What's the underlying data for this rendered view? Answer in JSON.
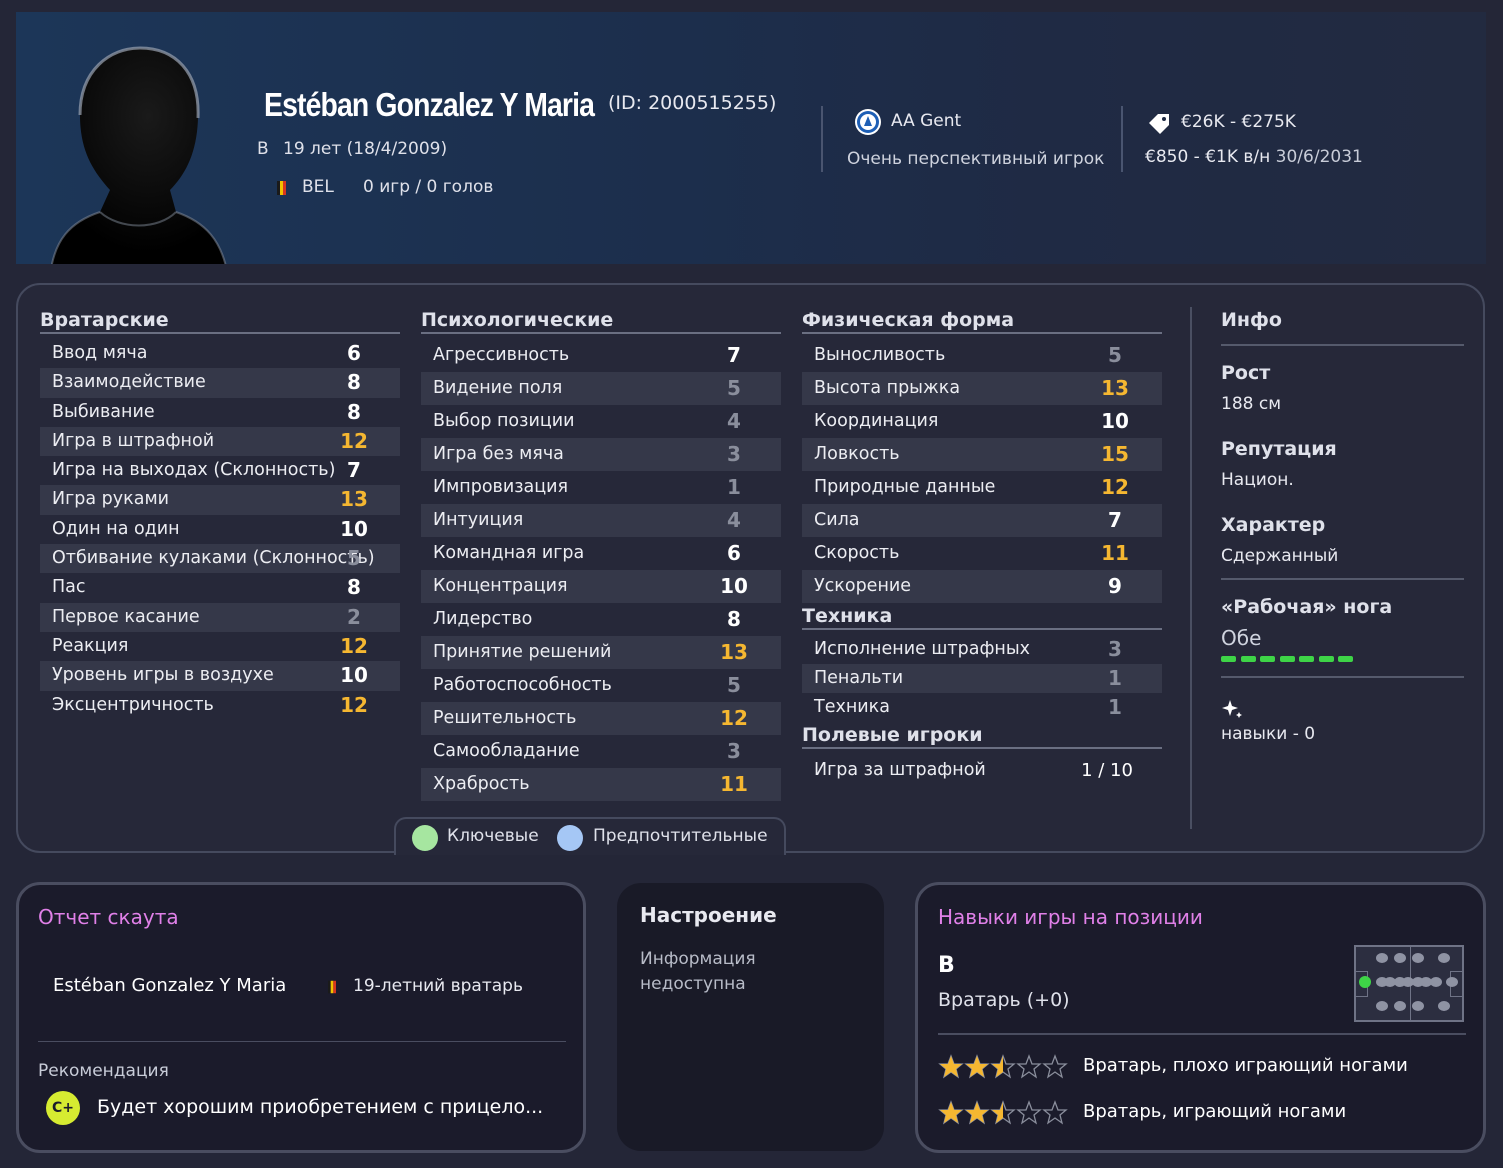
{
  "player": {
    "name": "Estéban Gonzalez Y Maria",
    "id_text": "(ID: 2000515255)",
    "position_letter": "В",
    "age_text": "19 лет (18/4/2009)",
    "nation": "BEL",
    "caps_text": "0 игр / 0 голов"
  },
  "club": {
    "name": "AA Gent",
    "status": "Очень перспективный игрок"
  },
  "finance": {
    "value": "€26K - €275K",
    "wage": "€850 - €1K  в/н",
    "contract": "30/6/2031"
  },
  "attributes": {
    "goalkeeping": {
      "title": "Вратарские",
      "rows": [
        {
          "name": "Ввод мяча",
          "value": "6",
          "color": "white"
        },
        {
          "name": "Взаимодействие",
          "value": "8",
          "color": "white"
        },
        {
          "name": "Выбивание",
          "value": "8",
          "color": "white"
        },
        {
          "name": "Игра в штрафной",
          "value": "12",
          "color": "gold"
        },
        {
          "name": "Игра на выходах (Склонность)",
          "value": "7",
          "color": "white"
        },
        {
          "name": "Игра руками",
          "value": "13",
          "color": "gold"
        },
        {
          "name": "Один на один",
          "value": "10",
          "color": "white"
        },
        {
          "name": "Отбивание кулаками (Склонность)",
          "value": "5",
          "color": "gray"
        },
        {
          "name": "Пас",
          "value": "8",
          "color": "white"
        },
        {
          "name": "Первое касание",
          "value": "2",
          "color": "gray"
        },
        {
          "name": "Реакция",
          "value": "12",
          "color": "gold"
        },
        {
          "name": "Уровень игры в воздухе",
          "value": "10",
          "color": "white"
        },
        {
          "name": "Эксцентричность",
          "value": "12",
          "color": "gold"
        }
      ]
    },
    "mental": {
      "title": "Психологические",
      "rows": [
        {
          "name": "Агрессивность",
          "value": "7",
          "color": "white"
        },
        {
          "name": "Видение поля",
          "value": "5",
          "color": "gray"
        },
        {
          "name": "Выбор позиции",
          "value": "4",
          "color": "gray"
        },
        {
          "name": "Игра без мяча",
          "value": "3",
          "color": "gray"
        },
        {
          "name": "Импровизация",
          "value": "1",
          "color": "gray"
        },
        {
          "name": "Интуиция",
          "value": "4",
          "color": "gray"
        },
        {
          "name": "Командная игра",
          "value": "6",
          "color": "white"
        },
        {
          "name": "Концентрация",
          "value": "10",
          "color": "white"
        },
        {
          "name": "Лидерство",
          "value": "8",
          "color": "white"
        },
        {
          "name": "Принятие решений",
          "value": "13",
          "color": "gold"
        },
        {
          "name": "Работоспособность",
          "value": "5",
          "color": "gray"
        },
        {
          "name": "Решительность",
          "value": "12",
          "color": "gold"
        },
        {
          "name": "Самообладание",
          "value": "3",
          "color": "gray"
        },
        {
          "name": "Храбрость",
          "value": "11",
          "color": "gold"
        }
      ]
    },
    "physical": {
      "title": "Физическая форма",
      "rows": [
        {
          "name": "Выносливость",
          "value": "5",
          "color": "gray"
        },
        {
          "name": "Высота прыжка",
          "value": "13",
          "color": "gold"
        },
        {
          "name": "Координация",
          "value": "10",
          "color": "white"
        },
        {
          "name": "Ловкость",
          "value": "15",
          "color": "gold"
        },
        {
          "name": "Природные данные",
          "value": "12",
          "color": "gold"
        },
        {
          "name": "Сила",
          "value": "7",
          "color": "white"
        },
        {
          "name": "Скорость",
          "value": "11",
          "color": "gold"
        },
        {
          "name": "Ускорение",
          "value": "9",
          "color": "white"
        }
      ]
    },
    "technical": {
      "title": "Техника",
      "rows": [
        {
          "name": "Исполнение штрафных",
          "value": "3",
          "color": "gray"
        },
        {
          "name": "Пенальти",
          "value": "1",
          "color": "gray"
        },
        {
          "name": "Техника",
          "value": "1",
          "color": "gray"
        }
      ]
    },
    "outfield": {
      "title": "Полевые игроки",
      "rows": [
        {
          "name": "Игра за штрафной",
          "value": "1 / 10",
          "color": "white"
        }
      ]
    }
  },
  "info": {
    "title": "Инфо",
    "height_label": "Рост",
    "height_value": "188 см",
    "reputation_label": "Репутация",
    "reputation_value": "Национ.",
    "character_label": "Характер",
    "character_value": "Сдержанный",
    "foot_label": "«Рабочая» нога",
    "foot_value": "Обе",
    "foot_level": 1.0,
    "skills_text": "навыки - 0"
  },
  "legend": {
    "key": "Ключевые",
    "preferred": "Предпочтительные"
  },
  "scout": {
    "title": "Отчет скаута",
    "name": "Estéban Gonzalez Y Maria",
    "desc": "19-летний вратарь",
    "rec_label": "Рекомендация",
    "grade": "C+",
    "rec_text": "Будет хорошим приобретением с прицело..."
  },
  "mood": {
    "title": "Настроение",
    "text_line1": "Информация",
    "text_line2": "недоступна"
  },
  "positions": {
    "title": "Навыки игры на позиции",
    "letter": "В",
    "role": "Вратарь (+0)",
    "roles": [
      {
        "name": "Вратарь, плохо играющий ногами",
        "stars": 2.5
      },
      {
        "name": "Вратарь, играющий ногами",
        "stars": 2.5
      }
    ]
  },
  "colors": {
    "gold": "#f5b731",
    "white": "#ffffff",
    "gray": "#8a8e9c",
    "key_green": "#a6e6a0",
    "preferred_blue": "#a5c7f5",
    "foot_green": "#3ed447",
    "pink": "#e080e8"
  }
}
